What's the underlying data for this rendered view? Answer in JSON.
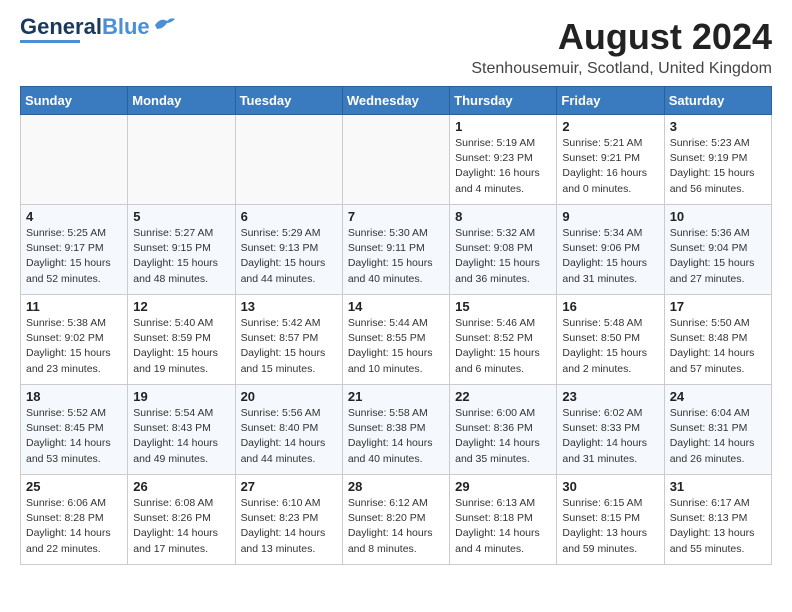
{
  "header": {
    "logo_line1": "General",
    "logo_line2": "Blue",
    "main_title": "August 2024",
    "subtitle": "Stenhousemuir, Scotland, United Kingdom"
  },
  "weekdays": [
    "Sunday",
    "Monday",
    "Tuesday",
    "Wednesday",
    "Thursday",
    "Friday",
    "Saturday"
  ],
  "weeks": [
    [
      {
        "day": "",
        "info": ""
      },
      {
        "day": "",
        "info": ""
      },
      {
        "day": "",
        "info": ""
      },
      {
        "day": "",
        "info": ""
      },
      {
        "day": "1",
        "info": "Sunrise: 5:19 AM\nSunset: 9:23 PM\nDaylight: 16 hours\nand 4 minutes."
      },
      {
        "day": "2",
        "info": "Sunrise: 5:21 AM\nSunset: 9:21 PM\nDaylight: 16 hours\nand 0 minutes."
      },
      {
        "day": "3",
        "info": "Sunrise: 5:23 AM\nSunset: 9:19 PM\nDaylight: 15 hours\nand 56 minutes."
      }
    ],
    [
      {
        "day": "4",
        "info": "Sunrise: 5:25 AM\nSunset: 9:17 PM\nDaylight: 15 hours\nand 52 minutes."
      },
      {
        "day": "5",
        "info": "Sunrise: 5:27 AM\nSunset: 9:15 PM\nDaylight: 15 hours\nand 48 minutes."
      },
      {
        "day": "6",
        "info": "Sunrise: 5:29 AM\nSunset: 9:13 PM\nDaylight: 15 hours\nand 44 minutes."
      },
      {
        "day": "7",
        "info": "Sunrise: 5:30 AM\nSunset: 9:11 PM\nDaylight: 15 hours\nand 40 minutes."
      },
      {
        "day": "8",
        "info": "Sunrise: 5:32 AM\nSunset: 9:08 PM\nDaylight: 15 hours\nand 36 minutes."
      },
      {
        "day": "9",
        "info": "Sunrise: 5:34 AM\nSunset: 9:06 PM\nDaylight: 15 hours\nand 31 minutes."
      },
      {
        "day": "10",
        "info": "Sunrise: 5:36 AM\nSunset: 9:04 PM\nDaylight: 15 hours\nand 27 minutes."
      }
    ],
    [
      {
        "day": "11",
        "info": "Sunrise: 5:38 AM\nSunset: 9:02 PM\nDaylight: 15 hours\nand 23 minutes."
      },
      {
        "day": "12",
        "info": "Sunrise: 5:40 AM\nSunset: 8:59 PM\nDaylight: 15 hours\nand 19 minutes."
      },
      {
        "day": "13",
        "info": "Sunrise: 5:42 AM\nSunset: 8:57 PM\nDaylight: 15 hours\nand 15 minutes."
      },
      {
        "day": "14",
        "info": "Sunrise: 5:44 AM\nSunset: 8:55 PM\nDaylight: 15 hours\nand 10 minutes."
      },
      {
        "day": "15",
        "info": "Sunrise: 5:46 AM\nSunset: 8:52 PM\nDaylight: 15 hours\nand 6 minutes."
      },
      {
        "day": "16",
        "info": "Sunrise: 5:48 AM\nSunset: 8:50 PM\nDaylight: 15 hours\nand 2 minutes."
      },
      {
        "day": "17",
        "info": "Sunrise: 5:50 AM\nSunset: 8:48 PM\nDaylight: 14 hours\nand 57 minutes."
      }
    ],
    [
      {
        "day": "18",
        "info": "Sunrise: 5:52 AM\nSunset: 8:45 PM\nDaylight: 14 hours\nand 53 minutes."
      },
      {
        "day": "19",
        "info": "Sunrise: 5:54 AM\nSunset: 8:43 PM\nDaylight: 14 hours\nand 49 minutes."
      },
      {
        "day": "20",
        "info": "Sunrise: 5:56 AM\nSunset: 8:40 PM\nDaylight: 14 hours\nand 44 minutes."
      },
      {
        "day": "21",
        "info": "Sunrise: 5:58 AM\nSunset: 8:38 PM\nDaylight: 14 hours\nand 40 minutes."
      },
      {
        "day": "22",
        "info": "Sunrise: 6:00 AM\nSunset: 8:36 PM\nDaylight: 14 hours\nand 35 minutes."
      },
      {
        "day": "23",
        "info": "Sunrise: 6:02 AM\nSunset: 8:33 PM\nDaylight: 14 hours\nand 31 minutes."
      },
      {
        "day": "24",
        "info": "Sunrise: 6:04 AM\nSunset: 8:31 PM\nDaylight: 14 hours\nand 26 minutes."
      }
    ],
    [
      {
        "day": "25",
        "info": "Sunrise: 6:06 AM\nSunset: 8:28 PM\nDaylight: 14 hours\nand 22 minutes."
      },
      {
        "day": "26",
        "info": "Sunrise: 6:08 AM\nSunset: 8:26 PM\nDaylight: 14 hours\nand 17 minutes."
      },
      {
        "day": "27",
        "info": "Sunrise: 6:10 AM\nSunset: 8:23 PM\nDaylight: 14 hours\nand 13 minutes."
      },
      {
        "day": "28",
        "info": "Sunrise: 6:12 AM\nSunset: 8:20 PM\nDaylight: 14 hours\nand 8 minutes."
      },
      {
        "day": "29",
        "info": "Sunrise: 6:13 AM\nSunset: 8:18 PM\nDaylight: 14 hours\nand 4 minutes."
      },
      {
        "day": "30",
        "info": "Sunrise: 6:15 AM\nSunset: 8:15 PM\nDaylight: 13 hours\nand 59 minutes."
      },
      {
        "day": "31",
        "info": "Sunrise: 6:17 AM\nSunset: 8:13 PM\nDaylight: 13 hours\nand 55 minutes."
      }
    ]
  ]
}
